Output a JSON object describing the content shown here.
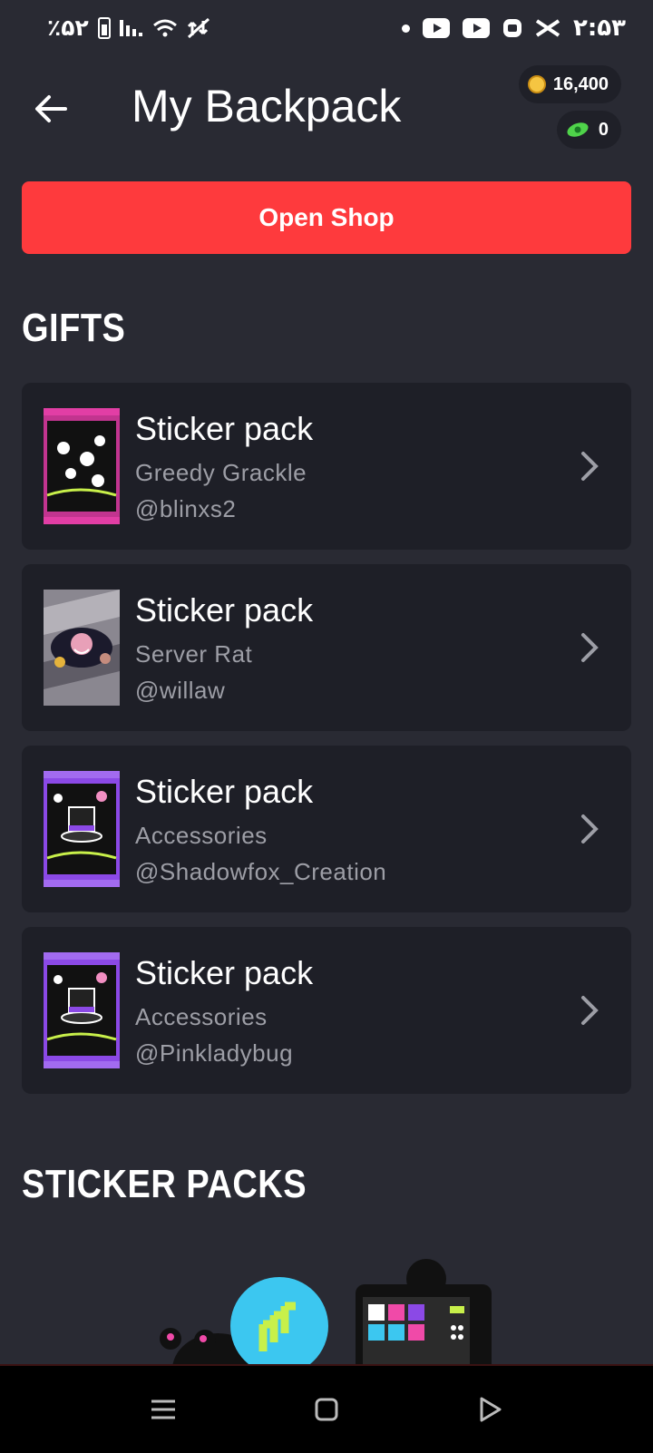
{
  "status_bar": {
    "battery": "٪۵۲",
    "time": "۲:۵۳"
  },
  "header": {
    "title": "My Backpack",
    "coins": "16,400",
    "cash": "0"
  },
  "shop_button": "Open Shop",
  "sections": {
    "gifts": "GIFTS",
    "sticker_packs": "STICKER PACKS"
  },
  "gifts": [
    {
      "title": "Sticker pack",
      "name": "Greedy Grackle",
      "user": "@blinxs2",
      "color": "#c2348f"
    },
    {
      "title": "Sticker pack",
      "name": "Server Rat",
      "user": "@willaw",
      "color": "#8a8790"
    },
    {
      "title": "Sticker pack",
      "name": "Accessories",
      "user": "@Shadowfox_Creation",
      "color": "#8b49e6"
    },
    {
      "title": "Sticker pack",
      "name": "Accessories",
      "user": "@Pinkladybug",
      "color": "#8b49e6"
    }
  ],
  "colors": {
    "background": "#292a33",
    "card": "#1e1f27",
    "accent": "#fe3a3d",
    "muted_text": "#9d9ea6"
  },
  "icons": [
    "back-arrow-icon",
    "coin-icon",
    "cash-icon",
    "chevron-right-icon",
    "menu-icon",
    "home-icon",
    "back-triangle-icon"
  ]
}
